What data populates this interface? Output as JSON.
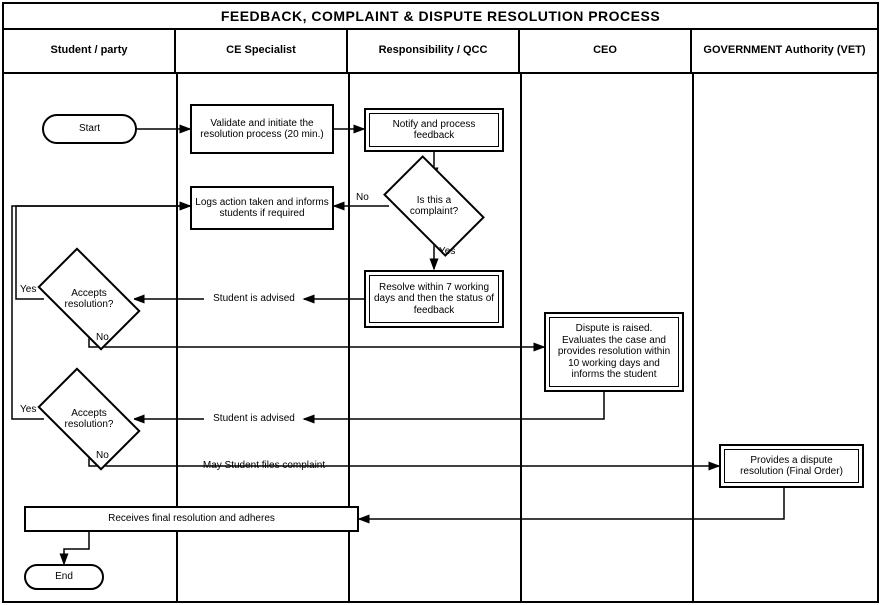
{
  "chart_data": {
    "type": "swimlane-flowchart",
    "title": "FEEDBACK, COMPLAINT & DISPUTE RESOLUTION PROCESS",
    "lanes": [
      "Student / party",
      "CE Specialist",
      "Responsibility / QCC",
      "CEO",
      "GOVERNMENT Authority (VET)"
    ],
    "nodes": [
      {
        "id": "start",
        "lane": 0,
        "type": "terminator",
        "label": "Start"
      },
      {
        "id": "validate",
        "lane": 1,
        "type": "process",
        "label": "Validate and initiate the resolution process (20 min.)"
      },
      {
        "id": "notify",
        "lane": 2,
        "type": "process-double",
        "label": "Notify and process feedback"
      },
      {
        "id": "isComplaint",
        "lane": 2,
        "type": "decision",
        "label": "Is this a complaint?"
      },
      {
        "id": "logAction",
        "lane": 1,
        "type": "process",
        "label": "Logs action taken and informs students if required"
      },
      {
        "id": "resolve",
        "lane": 2,
        "type": "process-double",
        "label": "Resolve within 7 working days and then the status of feedback"
      },
      {
        "id": "advise1",
        "lane": 1,
        "type": "text",
        "label": "Student is advised"
      },
      {
        "id": "accept1",
        "lane": 0,
        "type": "decision",
        "label": "Accepts resolution?"
      },
      {
        "id": "ceo",
        "lane": 3,
        "type": "process-double",
        "label": "Dispute is raised. Evaluates the case and provides resolution within 10 working days and informs the student"
      },
      {
        "id": "advise2",
        "lane": 1,
        "type": "text",
        "label": "Student is advised"
      },
      {
        "id": "accept2",
        "lane": 0,
        "type": "decision",
        "label": "Accepts resolution?"
      },
      {
        "id": "mayFile",
        "lane": 1,
        "type": "text",
        "label": "May Student files complaint"
      },
      {
        "id": "gov",
        "lane": 4,
        "type": "process-double",
        "label": "Provides a dispute resolution (Final Order)"
      },
      {
        "id": "final",
        "lane": 0,
        "type": "process",
        "span": 2,
        "label": "Receives final resolution and adheres"
      },
      {
        "id": "end",
        "lane": 0,
        "type": "terminator",
        "label": "End"
      }
    ],
    "edges": [
      {
        "from": "start",
        "to": "validate"
      },
      {
        "from": "validate",
        "to": "notify"
      },
      {
        "from": "notify",
        "to": "isComplaint"
      },
      {
        "from": "isComplaint",
        "to": "logAction",
        "label": "No"
      },
      {
        "from": "isComplaint",
        "to": "resolve",
        "label": "Yes"
      },
      {
        "from": "resolve",
        "to": "advise1"
      },
      {
        "from": "advise1",
        "to": "accept1"
      },
      {
        "from": "accept1",
        "to": "logAction",
        "label": "Yes"
      },
      {
        "from": "accept1",
        "to": "ceo",
        "label": "No"
      },
      {
        "from": "ceo",
        "to": "advise2"
      },
      {
        "from": "advise2",
        "to": "accept2"
      },
      {
        "from": "accept2",
        "to": "logAction",
        "label": "Yes"
      },
      {
        "from": "accept2",
        "to": "mayFile",
        "label": "No"
      },
      {
        "from": "mayFile",
        "to": "gov"
      },
      {
        "from": "gov",
        "to": "final"
      },
      {
        "from": "final",
        "to": "end"
      }
    ]
  },
  "title": "FEEDBACK, COMPLAINT & DISPUTE RESOLUTION PROCESS",
  "lanes": {
    "l0": "Student / party",
    "l1": "CE Specialist",
    "l2": "Responsibility / QCC",
    "l3": "CEO",
    "l4": "GOVERNMENT Authority (VET)"
  },
  "nodes": {
    "start": "Start",
    "validate": "Validate and initiate the resolution process (20 min.)",
    "notify": "Notify and process feedback",
    "isComplaint": "Is this a complaint?",
    "logAction": "Logs action taken and informs students if required",
    "resolve": "Resolve within 7 working days and then the status of feedback",
    "advise1": "Student is advised",
    "accept1": "Accepts resolution?",
    "ceo": "Dispute is raised. Evaluates the case and provides resolution within 10 working days and informs the student",
    "advise2": "Student is advised",
    "accept2": "Accepts resolution?",
    "mayFile": "May Student files complaint",
    "gov": "Provides a dispute resolution (Final Order)",
    "final": "Receives final resolution and adheres",
    "end": "End"
  },
  "labels": {
    "no": "No",
    "yes": "Yes"
  }
}
